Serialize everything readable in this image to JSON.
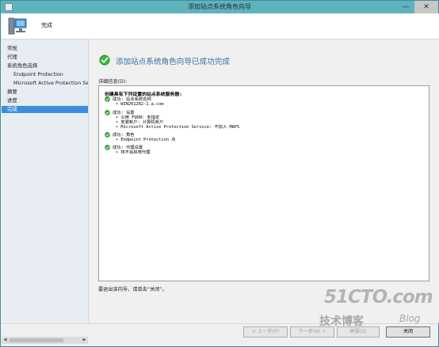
{
  "window": {
    "title": "添加站点系统角色向导",
    "minimize_glyph": "—",
    "close_glyph": "✕"
  },
  "header": {
    "title": "完成"
  },
  "sidebar": {
    "items": [
      {
        "label": "常规",
        "indent": 0,
        "active": false
      },
      {
        "label": "代理",
        "indent": 0,
        "active": false
      },
      {
        "label": "系统角色选择",
        "indent": 0,
        "active": false
      },
      {
        "label": "Endpoint Protection",
        "indent": 1,
        "active": false
      },
      {
        "label": "Microsoft Active Protection Se",
        "indent": 1,
        "active": false
      },
      {
        "label": "摘要",
        "indent": 0,
        "active": false
      },
      {
        "label": "进度",
        "indent": 0,
        "active": false
      },
      {
        "label": "完成",
        "indent": 0,
        "active": true
      }
    ],
    "scroll_left": "◀",
    "scroll_right": "▶"
  },
  "main": {
    "heading": "添加站点系统角色向导已成功完成",
    "details_label": "详细信息(D):",
    "details": {
      "header": "创建具有下列设置的站点系统服务器:",
      "groups": [
        {
          "title": "成功: 站点系统名称",
          "lines": [
            "• WIN2012R2-1.a.com"
          ]
        },
        {
          "title": "成功: 设置",
          "lines": [
            "• 公用 FQDN: 未指定",
            "• 安装帐户: 计算机帐户",
            "• Microsoft Active Protection Service: 不加入 MAPS"
          ]
        },
        {
          "title": "成功: 角色",
          "lines": [
            "• Endpoint Protection 点"
          ]
        },
        {
          "title": "成功: 代理设置",
          "lines": [
            "• 将不会启用代理"
          ]
        }
      ]
    },
    "footer_message": "要退出该向导，请单击“关闭”。"
  },
  "buttons": {
    "prev": "< 上一步(P)",
    "next": "下一步(N) >",
    "summary": "摘要(S)",
    "close": "关闭"
  },
  "watermark": {
    "main": "51CTO.com",
    "sub": "技术博客",
    "blog": "Blog"
  },
  "colors": {
    "titlebar": "#5fb3bd",
    "accent": "#3a8edb",
    "heading": "#2f6fa8",
    "success": "#2e9e2e"
  }
}
